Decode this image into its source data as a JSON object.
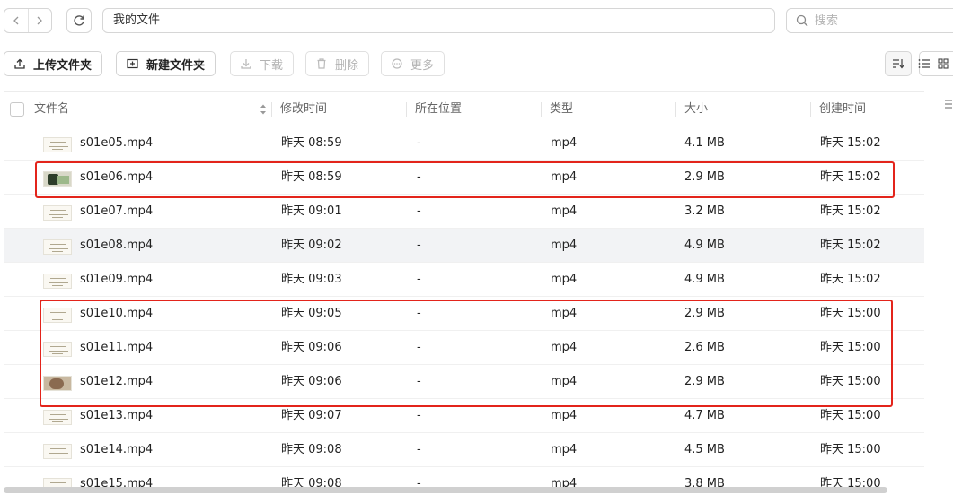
{
  "nav": {
    "back_icon": "chevron-left-icon",
    "forward_icon": "chevron-right-icon",
    "refresh_icon": "refresh-icon",
    "path": "我的文件",
    "search_placeholder": "搜索"
  },
  "toolbar": {
    "upload_folder": "上传文件夹",
    "new_folder": "新建文件夹",
    "download": "下载",
    "delete": "删除",
    "more": "更多"
  },
  "columns": {
    "name": "文件名",
    "modified": "修改时间",
    "location": "所在位置",
    "type": "类型",
    "size": "大小",
    "created": "创建时间"
  },
  "files": [
    {
      "name": "s01e05.mp4",
      "modified": "昨天 08:59",
      "location": "-",
      "type": "mp4",
      "size": "4.1 MB",
      "created": "昨天 15:02"
    },
    {
      "name": "s01e06.mp4",
      "modified": "昨天 08:59",
      "location": "-",
      "type": "mp4",
      "size": "2.9 MB",
      "created": "昨天 15:02"
    },
    {
      "name": "s01e07.mp4",
      "modified": "昨天 09:01",
      "location": "-",
      "type": "mp4",
      "size": "3.2 MB",
      "created": "昨天 15:02"
    },
    {
      "name": "s01e08.mp4",
      "modified": "昨天 09:02",
      "location": "-",
      "type": "mp4",
      "size": "4.9 MB",
      "created": "昨天 15:02"
    },
    {
      "name": "s01e09.mp4",
      "modified": "昨天 09:03",
      "location": "-",
      "type": "mp4",
      "size": "4.9 MB",
      "created": "昨天 15:02"
    },
    {
      "name": "s01e10.mp4",
      "modified": "昨天 09:05",
      "location": "-",
      "type": "mp4",
      "size": "2.9 MB",
      "created": "昨天 15:00"
    },
    {
      "name": "s01e11.mp4",
      "modified": "昨天 09:06",
      "location": "-",
      "type": "mp4",
      "size": "2.6 MB",
      "created": "昨天 15:00"
    },
    {
      "name": "s01e12.mp4",
      "modified": "昨天 09:06",
      "location": "-",
      "type": "mp4",
      "size": "2.9 MB",
      "created": "昨天 15:00"
    },
    {
      "name": "s01e13.mp4",
      "modified": "昨天 09:07",
      "location": "-",
      "type": "mp4",
      "size": "4.7 MB",
      "created": "昨天 15:00"
    },
    {
      "name": "s01e14.mp4",
      "modified": "昨天 09:08",
      "location": "-",
      "type": "mp4",
      "size": "4.5 MB",
      "created": "昨天 15:00"
    },
    {
      "name": "s01e15.mp4",
      "modified": "昨天 09:08",
      "location": "-",
      "type": "mp4",
      "size": "3.8 MB",
      "created": "昨天 15:00"
    }
  ],
  "colors": {
    "highlight": "#e3241b",
    "hover_row": "#f2f3f5"
  }
}
